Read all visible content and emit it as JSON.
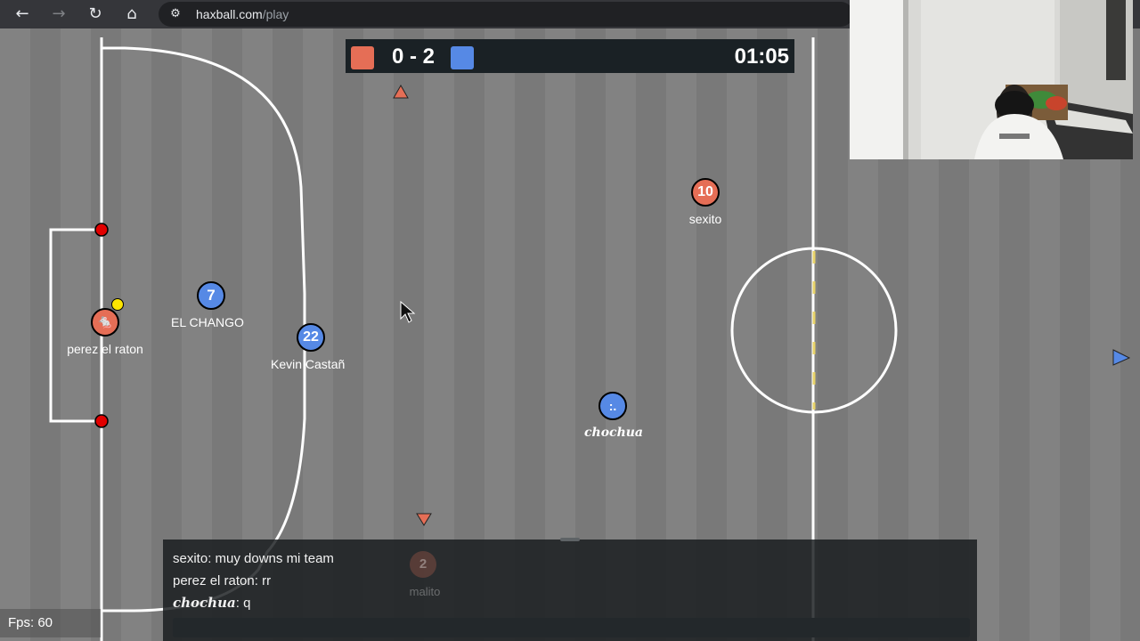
{
  "browser": {
    "back_icon": "←",
    "forward_icon": "→",
    "reload_icon": "↻",
    "home_icon": "⌂",
    "site_settings_icon": "⚙",
    "url_host": "haxball.com",
    "url_path": "/play"
  },
  "scoreboard": {
    "score": "0 - 2",
    "red_score": 0,
    "blue_score": 2,
    "time": "01:05",
    "red_color": "#e56e56",
    "blue_color": "#5689e5"
  },
  "players": {
    "red_keeper": {
      "avatar": "🐁",
      "name": "perez el raton",
      "team": "red"
    },
    "red_forward": {
      "avatar": "10",
      "name": "sexito",
      "team": "red"
    },
    "blue_seven": {
      "avatar": "7",
      "name": "EL CHANGO",
      "team": "blue"
    },
    "blue_twentytwo": {
      "avatar": "22",
      "name": "Kevin Castañ",
      "team": "blue"
    },
    "blue_chochua": {
      "avatar": ":.",
      "name": "chochua",
      "team": "blue"
    },
    "faded": {
      "avatar": "2",
      "name": "malito",
      "team": "red"
    }
  },
  "chat": {
    "messages": [
      {
        "author": "sexito",
        "text": "muy downs mi team"
      },
      {
        "author": "perez el raton",
        "text": "rr"
      },
      {
        "author": "chochua",
        "text": "q"
      }
    ],
    "input_value": ""
  },
  "fps_label": "Fps: 60"
}
